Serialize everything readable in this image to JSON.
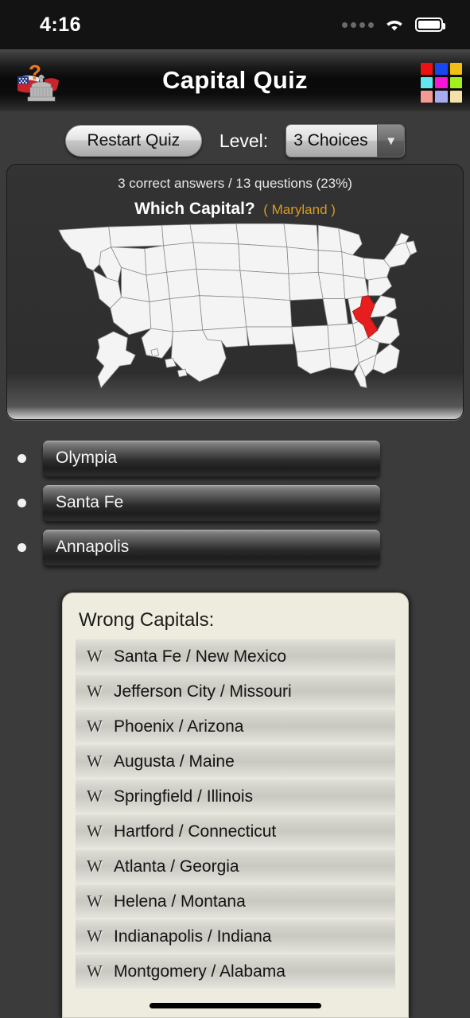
{
  "status_bar": {
    "time": "4:16",
    "cellular_icon": "cellular-dots-icon",
    "wifi_icon": "wifi-icon",
    "battery_icon": "battery-full-icon"
  },
  "nav_bar": {
    "title": "Capital Quiz",
    "app_icon": "capitol-flag-question-icon",
    "grid_icon": "color-grid-icon",
    "grid_colors": [
      "#ef1111",
      "#1a46f0",
      "#f2c015",
      "#63e7ef",
      "#f514d8",
      "#a3ef1e",
      "#f59a93",
      "#a6acf0",
      "#f5e0a8"
    ]
  },
  "toolbar": {
    "restart_label": "Restart Quiz",
    "level_label": "Level:",
    "level_value": "3 Choices",
    "level_options": [
      "3 Choices"
    ],
    "dropdown_icon": "chevron-down-icon"
  },
  "quiz": {
    "score_text": "3 correct answers / 13 questions (23%)",
    "question_label": "Which Capital?",
    "state_hint": "( Maryland )",
    "correct_count": 3,
    "question_count": 13,
    "percent": "23%",
    "highlight_color": "#e81e1e",
    "map_fill": "#f4f4f4",
    "map_name": "united-states-map"
  },
  "answers": {
    "items": [
      {
        "label": "Olympia"
      },
      {
        "label": "Santa Fe"
      },
      {
        "label": "Annapolis"
      }
    ]
  },
  "wrong_capitals": {
    "title": "Wrong Capitals:",
    "marker": "W",
    "items": [
      {
        "label": "Santa Fe / New Mexico"
      },
      {
        "label": "Jefferson City / Missouri"
      },
      {
        "label": "Phoenix / Arizona"
      },
      {
        "label": "Augusta / Maine"
      },
      {
        "label": "Springfield / Illinois"
      },
      {
        "label": "Hartford / Connecticut"
      },
      {
        "label": "Atlanta / Georgia"
      },
      {
        "label": "Helena / Montana"
      },
      {
        "label": "Indianapolis / Indiana"
      },
      {
        "label": "Montgomery / Alabama"
      }
    ]
  }
}
